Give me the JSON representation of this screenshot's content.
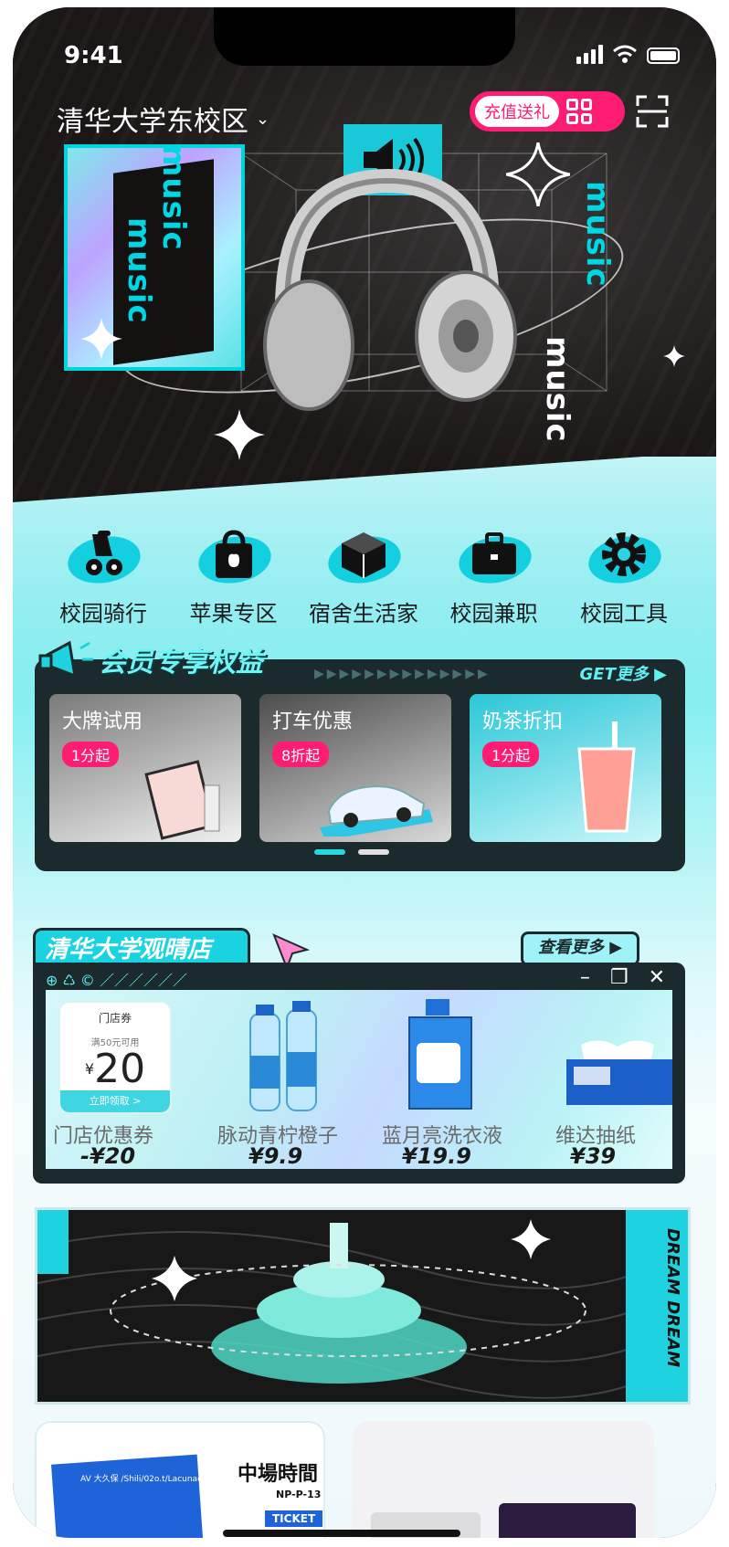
{
  "status_bar": {
    "time": "9:41"
  },
  "header": {
    "location": "清华大学东校区",
    "recharge_label": "充值送礼"
  },
  "hero": {
    "music_text": "music"
  },
  "categories": [
    {
      "label": "校园骑行",
      "icon": "scooter-icon"
    },
    {
      "label": "苹果专区",
      "icon": "apple-bag-icon"
    },
    {
      "label": "宿舍生活家",
      "icon": "package-box-icon"
    },
    {
      "label": "校园兼职",
      "icon": "briefcase-icon"
    },
    {
      "label": "校园工具",
      "icon": "gear-icon"
    }
  ],
  "member": {
    "title": "会员专享权益",
    "more_label": "GET更多",
    "cards": [
      {
        "title": "大牌试用",
        "badge": "1分起"
      },
      {
        "title": "打车优惠",
        "badge": "8折起"
      },
      {
        "title": "奶茶折扣",
        "badge": "1分起"
      }
    ]
  },
  "store": {
    "title": "清华大学观晴店",
    "see_more": "查看更多",
    "coupon": {
      "header": "门店券",
      "condition": "满50元可用",
      "currency": "¥",
      "amount": "20",
      "button": "立即领取 >"
    },
    "products": [
      {
        "name": "门店优惠券",
        "price": "-¥20"
      },
      {
        "name": "脉动青柠橙子",
        "price": "¥9.9"
      },
      {
        "name": "蓝月亮洗衣液",
        "price": "¥19.9"
      },
      {
        "name": "维达抽纸",
        "price": "¥39"
      }
    ]
  },
  "banner": {
    "side_text": "DREAM DREAM"
  },
  "ticket": {
    "title": "中場時間",
    "code": "NP-P-13",
    "label": "TICKET",
    "small_text": "AV 大久保 /Shili/02o.t/Lacunae"
  },
  "colors": {
    "accent": "#19d3e0",
    "pink": "#ff1d74",
    "dark": "#1b2a2d"
  }
}
